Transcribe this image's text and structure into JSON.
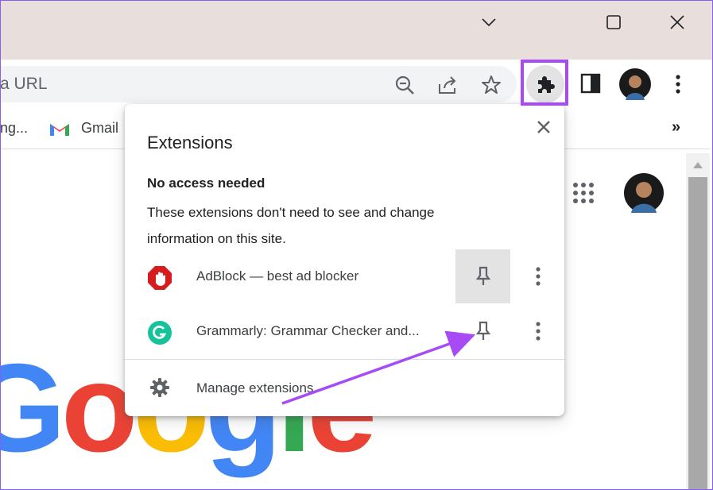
{
  "omnibox": {
    "text": "a URL"
  },
  "bookmarks": {
    "items": [
      {
        "label": "ng..."
      },
      {
        "label": "Gmail"
      }
    ],
    "overflow": "»"
  },
  "popup": {
    "title": "Extensions",
    "section_heading": "No access needed",
    "section_description": "These extensions don't need to see and change information on this site.",
    "extensions": [
      {
        "name": "AdBlock — best ad blocker",
        "icon": "adblock-icon"
      },
      {
        "name": "Grammarly: Grammar Checker and...",
        "icon": "grammarly-icon"
      }
    ],
    "manage_label": "Manage extensions"
  },
  "google_logo": {
    "letters": [
      "G",
      "o",
      "o",
      "g",
      "l",
      "e"
    ]
  },
  "colors": {
    "annotation_purple": "#a64bf5",
    "adblock_red": "#d61d1d",
    "grammarly_green": "#15c39a",
    "google_blue": "#4285f4",
    "google_red": "#ea4335",
    "google_yellow": "#fbbc05",
    "google_green": "#34a853"
  }
}
